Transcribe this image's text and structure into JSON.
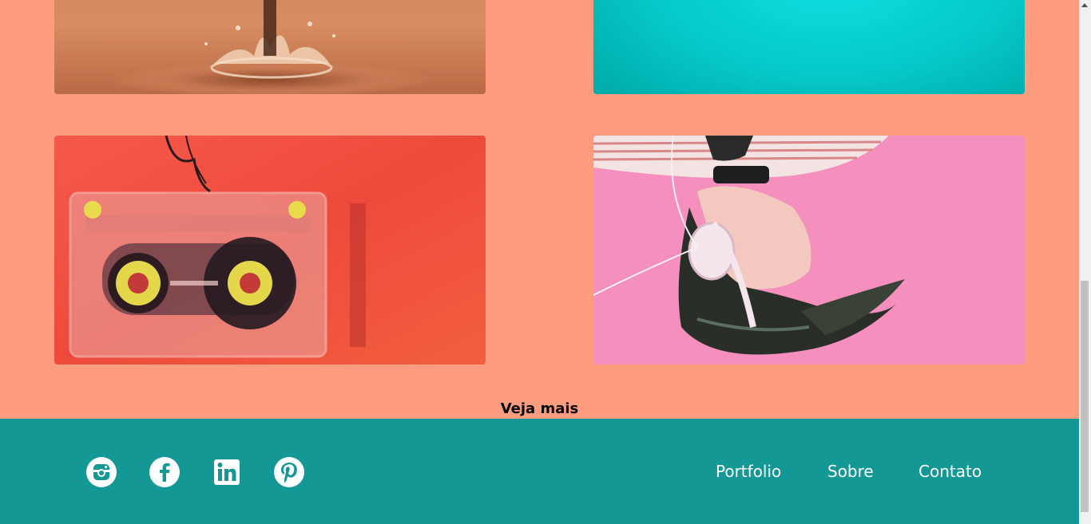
{
  "gallery": {
    "images": [
      {
        "name": "water-splash-image"
      },
      {
        "name": "turquoise-gradient-image"
      },
      {
        "name": "cassette-tape-image"
      },
      {
        "name": "headphones-girl-image"
      }
    ]
  },
  "see_more": {
    "label": "Veja mais"
  },
  "footer": {
    "social": [
      {
        "icon": "instagram-icon"
      },
      {
        "icon": "facebook-icon"
      },
      {
        "icon": "linkedin-icon"
      },
      {
        "icon": "pinterest-icon"
      }
    ],
    "nav": {
      "portfolio": "Portfolio",
      "sobre": "Sobre",
      "contato": "Contato"
    }
  },
  "colors": {
    "page_background": "#fe9c7f",
    "footer_background": "#139896",
    "footer_text": "#ffffff"
  }
}
